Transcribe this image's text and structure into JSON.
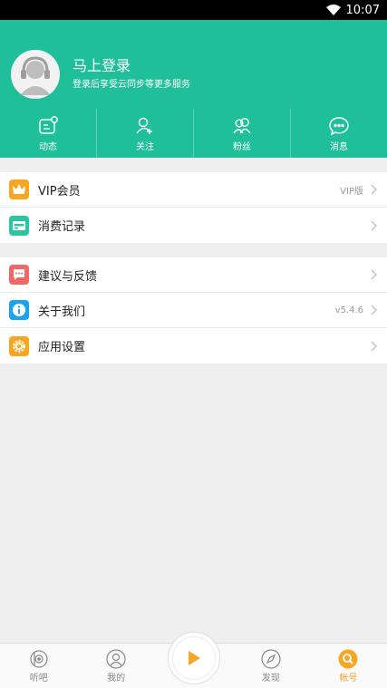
{
  "status_bar": {
    "time": "10:07"
  },
  "profile": {
    "title": "马上登录",
    "subtitle": "登录后享受云同步等更多服务"
  },
  "quick_actions": [
    {
      "label": "动态",
      "icon": "feed-icon"
    },
    {
      "label": "关注",
      "icon": "follow-icon"
    },
    {
      "label": "粉丝",
      "icon": "fans-icon"
    },
    {
      "label": "消息",
      "icon": "message-icon"
    }
  ],
  "menu_groups": {
    "group1": [
      {
        "label": "VIP会员",
        "value": "VIP版",
        "icon": "crown-icon",
        "color": "#f5a623"
      },
      {
        "label": "消费记录",
        "value": "",
        "icon": "wallet-icon",
        "color": "#2ec4a0"
      }
    ],
    "group2": [
      {
        "label": "建议与反馈",
        "value": "",
        "icon": "feedback-icon",
        "color": "#f06767"
      },
      {
        "label": "关于我们",
        "value": "v5.4.6",
        "icon": "info-icon",
        "color": "#1aa3e8"
      },
      {
        "label": "应用设置",
        "value": "",
        "icon": "settings-icon",
        "color": "#f5a623"
      }
    ]
  },
  "tabbar": [
    {
      "label": "听吧",
      "icon": "radio-icon"
    },
    {
      "label": "我的",
      "icon": "user-icon"
    },
    {
      "label": "",
      "icon": "play-icon"
    },
    {
      "label": "发现",
      "icon": "compass-icon"
    },
    {
      "label": "帐号",
      "icon": "account-icon",
      "active": true
    }
  ],
  "colors": {
    "accent": "#1fbf9a",
    "active_tab": "#f5a623"
  }
}
